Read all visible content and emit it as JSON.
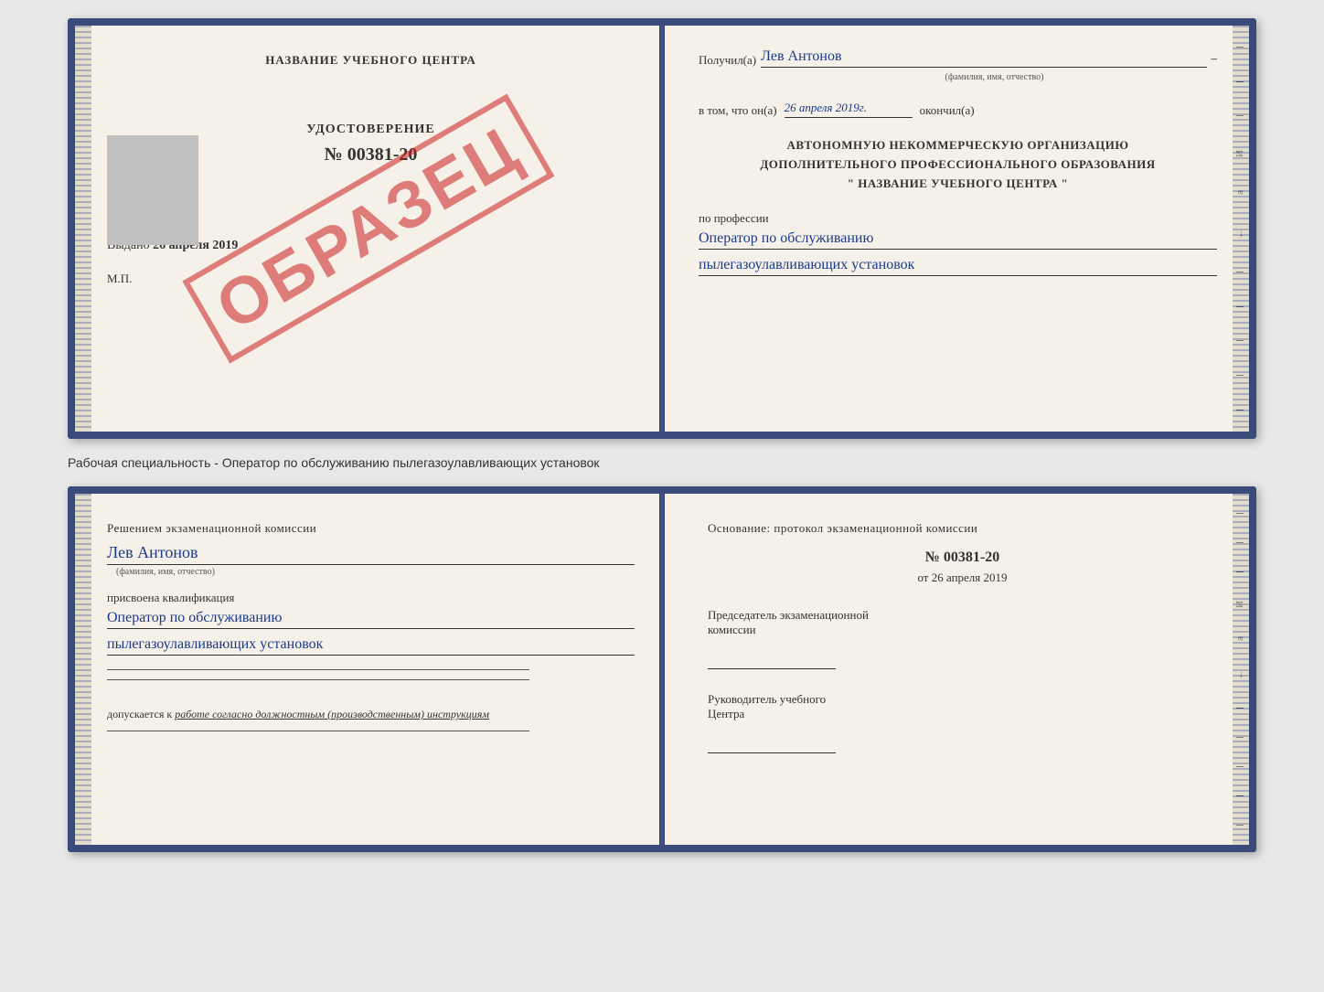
{
  "diploma": {
    "left": {
      "header": "НАЗВАНИЕ УЧЕБНОГО ЦЕНТРА",
      "udostoverenie_title": "УДОСТОВЕРЕНИЕ",
      "udostoverenie_number": "№ 00381-20",
      "vydano_label": "Выдано",
      "vydano_date": "26 апреля 2019",
      "mp_label": "М.П.",
      "obrazets": "ОБРАЗЕЦ"
    },
    "right": {
      "poluchil_label": "Получил(а)",
      "poluchil_name": "Лев Антонов",
      "fio_label": "(фамилия, имя, отчество)",
      "vtom_prefix": "в том, что он(а)",
      "vtom_date": "26 апреля 2019г.",
      "okончил": "окончил(а)",
      "org_line1": "АВТОНОМНУЮ НЕКОММЕРЧЕСКУЮ ОРГАНИЗАЦИЮ",
      "org_line2": "ДОПОЛНИТЕЛЬНОГО ПРОФЕССИОНАЛЬНОГО ОБРАЗОВАНИЯ",
      "org_line3": "\"  НАЗВАНИЕ УЧЕБНОГО ЦЕНТРА  \"",
      "po_professii": "по профессии",
      "profession_line1": "Оператор по обслуживанию",
      "profession_line2": "пылегазоулавливающих установок"
    }
  },
  "between": {
    "text": "Рабочая специальность - Оператор по обслуживанию пылегазоулавливающих установок"
  },
  "certificate": {
    "left": {
      "resheniem_line": "Решением экзаменационной комиссии",
      "person_name": "Лев Антонов",
      "fio_label": "(фамилия, имя, отчество)",
      "prisvoena": "присвоена квалификация",
      "kvalif_line1": "Оператор по обслуживанию",
      "kvalif_line2": "пылегазоулавливающих установок",
      "dopuskaetsya_prefix": "допускается к",
      "dopuskaetsya_text": "работе согласно должностным (производственным) инструкциям"
    },
    "right": {
      "osnovanie": "Основание: протокол экзаменационной комиссии",
      "protocol_number": "№  00381-20",
      "ot_prefix": "от",
      "ot_date": "26 апреля 2019",
      "predsedatel_line1": "Председатель экзаменационной",
      "predsedatel_line2": "комиссии",
      "rukovoditel_line1": "Руководитель учебного",
      "rukovoditel_line2": "Центра"
    }
  }
}
